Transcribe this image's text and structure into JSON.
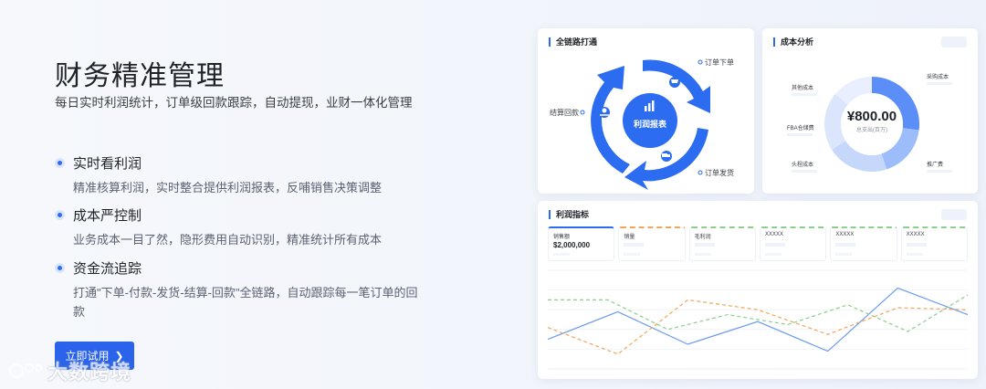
{
  "hero": {
    "title": "财务精准管理",
    "subtitle": "每日实时利润统计，订单级回款跟踪，自动提现，业财一体化管理"
  },
  "features": [
    {
      "title": "实时看利润",
      "desc": "精准核算利润，实时整合提供利润报表，反哺销售决策调整"
    },
    {
      "title": "成本严控制",
      "desc": "业务成本一目了然，隐形费用自动识别，精准统计所有成本"
    },
    {
      "title": "资金流追踪",
      "desc": "打通\"下单-付款-发货-结算-回款\"全链路，自动跟踪每一笔订单的回款"
    }
  ],
  "cta": {
    "label": "立即试用",
    "icon": "chevron-right-icon"
  },
  "chain_card": {
    "title": "全链路打通",
    "center_label": "利润报表",
    "steps": [
      "订单下单",
      "订单发货",
      "结算回款"
    ],
    "colors": {
      "primary": "#2b6cf0",
      "secondary": "#3d7ef5"
    }
  },
  "cost_card": {
    "title": "成本分析",
    "center_value": "¥800.00",
    "center_sub": "总支出(百万)",
    "labels": {
      "top_left": "其他成本",
      "mid_left": "FBA仓储费",
      "bottom_left": "头程成本",
      "top_right": "采购成本",
      "bottom_right": "推广费"
    },
    "chart_data": {
      "type": "pie",
      "categories": [
        "采购成本",
        "推广费",
        "头程成本",
        "FBA仓储费",
        "其他成本"
      ],
      "values": [
        27,
        18,
        21,
        20,
        14
      ],
      "colors": [
        "#5b8ef7",
        "#9dbcfa",
        "#c6d7fc",
        "#dbe6fd",
        "#e9effe"
      ]
    }
  },
  "profit_card": {
    "title": "利润指标",
    "metrics": [
      {
        "label": "销售额",
        "value": "$2,000,000"
      },
      {
        "label": "销量",
        "value": ""
      },
      {
        "label": "毛利润",
        "value": ""
      },
      {
        "label": "XXXXX",
        "value": ""
      },
      {
        "label": "XXXXX",
        "value": ""
      },
      {
        "label": "XXXXX",
        "value": ""
      }
    ],
    "chart_data": {
      "type": "line",
      "x": [
        0,
        1,
        2,
        3,
        4,
        5,
        6,
        7
      ],
      "ylim": [
        0,
        100
      ],
      "series": [
        {
          "values": [
            30,
            58,
            25,
            48,
            18,
            82,
            55
          ],
          "color": "#6b9cf0",
          "dash": "none"
        },
        {
          "values": [
            70,
            70,
            40,
            55,
            45,
            65,
            38,
            75
          ],
          "color": "#8ccf8c",
          "dash": "4 3"
        },
        {
          "values": [
            42,
            15,
            70,
            60,
            35,
            62,
            60
          ],
          "color": "#f2a55a",
          "dash": "4 3"
        }
      ]
    }
  },
  "watermark": {
    "text": "大数跨境"
  }
}
